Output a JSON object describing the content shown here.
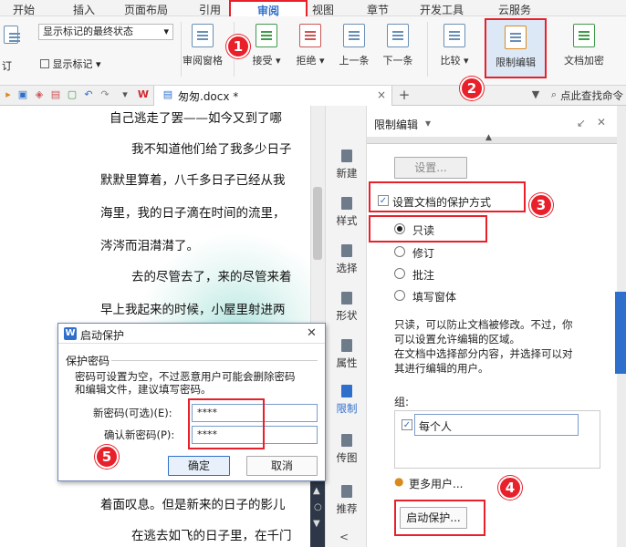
{
  "menubar": {
    "items": [
      "开始",
      "插入",
      "页面布局",
      "引用",
      "审阅",
      "视图",
      "章节",
      "开发工具",
      "云服务"
    ],
    "active": "审阅"
  },
  "ribbon": {
    "markup_display": "显示标记的最终状态",
    "show_markup": "显示标记",
    "left_fragment": "订",
    "review_pane": "审阅窗格",
    "accept": "接受",
    "reject": "拒绝",
    "previous": "上一条",
    "next": "下一条",
    "compare": "比较",
    "restrict_editing": "限制编辑",
    "doc_encrypt": "文档加密"
  },
  "toolbar": {
    "tab_name": "匆匆.docx *",
    "find_command": "点此查找命令"
  },
  "document": {
    "lines": [
      "自己逃走了罢——如今又到了哪",
      "我不知道他们给了我多少日子",
      "默默里算着，八千多日子已经从我",
      "海里，我的日子滴在时间的流里，",
      "涔涔而泪潸潸了。",
      "去的尽管去了，来的尽管来着",
      "早上我起来的时候，小屋里射进两",
      "着面叹息。但是新来的日子的影儿",
      "在逃去如飞的日子里，在千门"
    ]
  },
  "rail": {
    "items": [
      "新建",
      "样式",
      "选择",
      "形状",
      "属性",
      "限制",
      "传图",
      "推荐"
    ]
  },
  "panel": {
    "title": "限制编辑",
    "settings_button": "设置...",
    "protect_checkbox": "设置文档的保护方式",
    "options": [
      "只读",
      "修订",
      "批注",
      "填写窗体"
    ],
    "selected_option": "只读",
    "description": [
      "只读，可以防止文档被修改。不过，你",
      "可以设置允许编辑的区域。",
      "在文档中选择部分内容，并选择可以对",
      "其进行编辑的用户。"
    ],
    "group_label": "组:",
    "group_item": "每个人",
    "more_users": "更多用户...",
    "start_protection": "启动保护..."
  },
  "dialog": {
    "title": "启动保护",
    "section": "保护密码",
    "note_line1": "密码可设置为空，不过恶意用户可能会删除密码",
    "note_line2": "和编辑文件，建议填写密码。",
    "new_password_label": "新密码(可选)(E):",
    "new_password_value": "****",
    "confirm_label": "确认新密码(P):",
    "confirm_value": "****",
    "ok": "确定",
    "cancel": "取消"
  },
  "badges": [
    "1",
    "2",
    "3",
    "4",
    "5"
  ],
  "colors": {
    "accent_red": "#e8202a",
    "wps_blue": "#2f6fcc"
  }
}
